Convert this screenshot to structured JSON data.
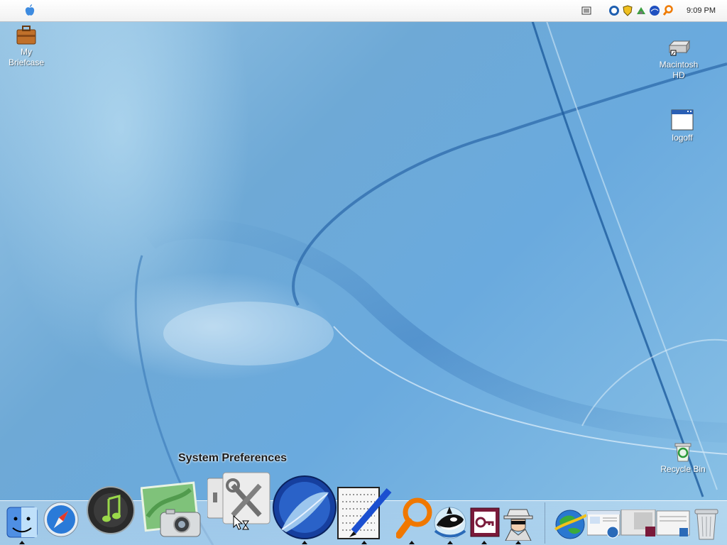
{
  "menubar": {
    "apple_menu_icon": "apple-icon",
    "tray_icons": [
      "keyboard-icon",
      "clock-app-icon",
      "shield-icon",
      "network-icon",
      "globe-icon",
      "search-icon"
    ],
    "clock": "9:09 PM"
  },
  "desktop_icons": {
    "briefcase": {
      "label": "My\nBriefcase",
      "icon": "briefcase-icon"
    },
    "macintosh_hd": {
      "label": "Macintosh\nHD",
      "icon": "hard-drive-icon"
    },
    "logoff": {
      "label": "logoff",
      "icon": "window-icon"
    },
    "recycle_bin": {
      "label": "Recycle Bin",
      "icon": "recycle-bin-icon"
    }
  },
  "dock": {
    "tooltip": "System Preferences",
    "items": [
      {
        "name": "finder",
        "icon": "finder-icon",
        "running": true
      },
      {
        "name": "safari",
        "icon": "safari-compass-icon",
        "running": false
      },
      {
        "name": "itunes",
        "icon": "itunes-music-icon",
        "running": false
      },
      {
        "name": "iphoto",
        "icon": "iphoto-camera-icon",
        "running": false
      },
      {
        "name": "system-preferences",
        "icon": "tools-icon",
        "running": false
      },
      {
        "name": "feather-app",
        "icon": "feather-icon",
        "running": true
      },
      {
        "name": "editor",
        "icon": "pen-grid-icon",
        "running": true
      },
      {
        "name": "search",
        "icon": "magnifier-icon",
        "running": true
      },
      {
        "name": "orca-app",
        "icon": "orca-icon",
        "running": true
      },
      {
        "name": "access",
        "icon": "key-icon",
        "running": true
      },
      {
        "name": "spy",
        "icon": "spy-icon",
        "running": true
      },
      {
        "name": "internet",
        "icon": "globe-arrow-icon",
        "running": false
      },
      {
        "name": "window-thumbnails",
        "icon": "window-thumbnail-icon",
        "running": false
      },
      {
        "name": "trash",
        "icon": "trash-icon",
        "running": false
      }
    ]
  },
  "colors": {
    "accent": "#1b4fa8",
    "wallpaper": "#6ea9d6"
  }
}
